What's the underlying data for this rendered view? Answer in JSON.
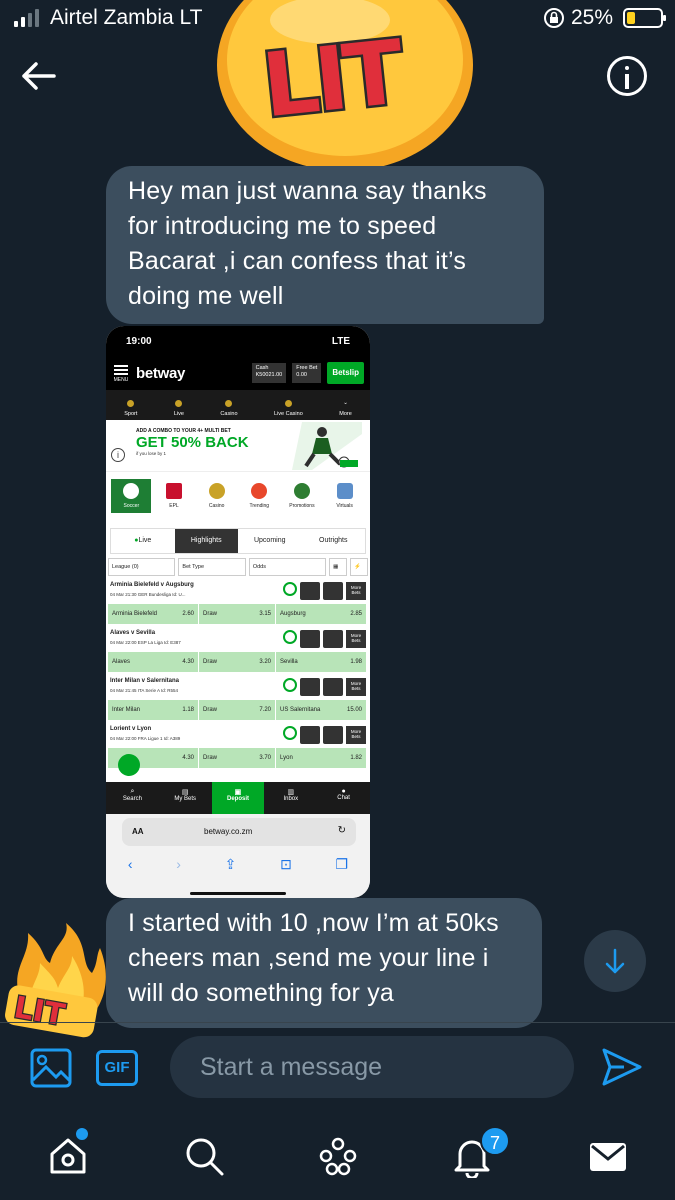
{
  "status_bar": {
    "carrier": "Airtel Zambia  LT",
    "battery": "25%"
  },
  "messages": [
    {
      "text": "Hey man just wanna say thanks for introducing me to speed Bacarat ,i can confess that it’s doing me well"
    },
    {
      "text": "I started with 10 ,now I’m at 50ks cheers man ,send me your line i will do something for ya"
    }
  ],
  "stickers": {
    "top": "LIT",
    "fire": "LIT"
  },
  "shared_screenshot": {
    "time": "19:00",
    "network": "LTE",
    "brand": "betway",
    "menu_label": "MENU",
    "cash_label": "Cash",
    "cash_value": "K50021.00",
    "free_bet_label": "Free Bet",
    "free_bet_value": "0.00",
    "betslip": "Betslip",
    "nav": [
      "Sport",
      "Live",
      "Casino",
      "Live Casino",
      "More"
    ],
    "banner_line1": "ADD A COMBO TO YOUR 4+ MULTI BET",
    "banner_line2": "GET 50% BACK",
    "banner_line3": "if you lose by 1",
    "categories": [
      "Soccer",
      "EPL",
      "Casino",
      "Trending",
      "Promotions",
      "Virtuals"
    ],
    "tabs": [
      "Live",
      "Highlights",
      "Upcoming",
      "Outrights"
    ],
    "filters": [
      "League (0)",
      "Bet Type",
      "Odds"
    ],
    "matches": [
      {
        "name": "Arminia Bielefeld v Augsburg",
        "info": "04 Mar 21:30 GER Bundesliga Id: U...",
        "home": "Arminia Bielefeld",
        "home_odd": "2.60",
        "draw": "Draw",
        "draw_odd": "3.15",
        "away": "Augsburg",
        "away_odd": "2.85"
      },
      {
        "name": "Alaves v Sevilla",
        "info": "04 Mar 22:00 ESP La Liga Id: E387",
        "home": "Alaves",
        "home_odd": "4.30",
        "draw": "Draw",
        "draw_odd": "3.20",
        "away": "Sevilla",
        "away_odd": "1.98"
      },
      {
        "name": "Inter Milan v Salernitana",
        "info": "04 Mar 21:45 ITA Serie A Id: R554",
        "home": "Inter Milan",
        "home_odd": "1.18",
        "draw": "Draw",
        "draw_odd": "7.20",
        "away": "US Salernitana",
        "away_odd": "15.00"
      },
      {
        "name": "Lorient v Lyon",
        "info": "04 Mar 22:00 FRA Ligue 1 Id: A389",
        "home": "",
        "home_odd": "4.30",
        "draw": "Draw",
        "draw_odd": "3.70",
        "away": "Lyon",
        "away_odd": "1.82"
      }
    ],
    "more_bets": "More Bets",
    "bottom_nav": [
      "Search",
      "My Bets",
      "Deposit",
      "Inbox",
      "Chat"
    ],
    "url_aa": "AA",
    "url": "betway.co.zm"
  },
  "composer": {
    "placeholder": "Start a message",
    "gif_label": "GIF"
  },
  "tabbar": {
    "notifications_count": "7"
  },
  "colors": {
    "background": "#15202b",
    "bubble": "#3c4e5e",
    "accent": "#1d9bf0",
    "betway_green": "#00a826"
  }
}
